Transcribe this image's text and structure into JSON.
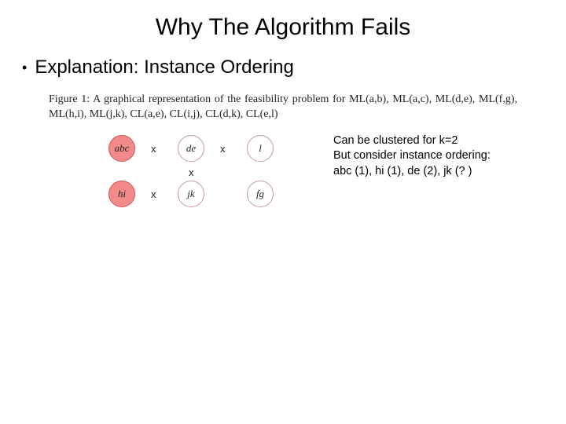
{
  "title": "Why The Algorithm Fails",
  "bullet": "Explanation: Instance Ordering",
  "figure_caption": "Figure 1:  A graphical representation of the feasibility problem for ML(a,b), ML(a,c), ML(d,e), ML(f,g), ML(h,i), ML(j,k), CL(a,e), CL(i,j), CL(d,k), CL(e,l)",
  "nodes": {
    "abc": "abc",
    "de": "de",
    "l": "l",
    "hi": "hi",
    "jk": "jk",
    "fg": "fg"
  },
  "x": "x",
  "side": {
    "line1": "Can be clustered for k=2",
    "line2": "But consider instance ordering:",
    "line3": "abc (1), hi (1), de (2), jk (? )"
  }
}
